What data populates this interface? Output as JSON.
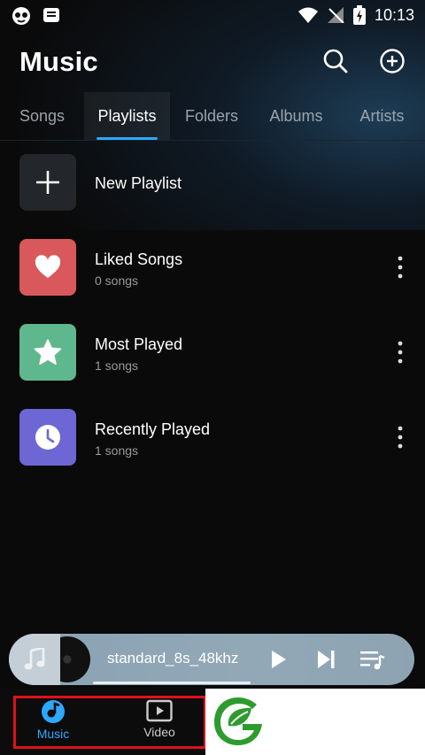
{
  "status_bar": {
    "time": "10:13"
  },
  "header": {
    "title": "Music"
  },
  "tabs": [
    {
      "label": "Songs",
      "active": false
    },
    {
      "label": "Playlists",
      "active": true
    },
    {
      "label": "Folders",
      "active": false
    },
    {
      "label": "Albums",
      "active": false
    },
    {
      "label": "Artists",
      "active": false
    }
  ],
  "new_playlist": {
    "label": "New Playlist"
  },
  "playlists": [
    {
      "title": "Liked Songs",
      "count": "0 songs",
      "icon": "heart-icon",
      "color": "#d9585b"
    },
    {
      "title": "Most Played",
      "count": "1 songs",
      "icon": "star-icon",
      "color": "#5fb88d"
    },
    {
      "title": "Recently Played",
      "count": "1 songs",
      "icon": "clock-icon",
      "color": "#6c67d4"
    }
  ],
  "player": {
    "track": "standard_8s_48khz",
    "accent": "#2ea7ff"
  },
  "bottom_nav": [
    {
      "label": "Music",
      "active": true
    },
    {
      "label": "Video",
      "active": false
    }
  ],
  "colors": {
    "accent": "#2ea7ff",
    "highlight": "#e0111a",
    "logo_green": "#2e9b2e"
  }
}
